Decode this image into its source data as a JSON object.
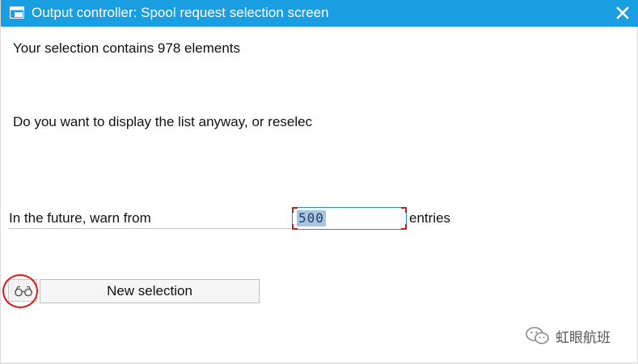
{
  "window": {
    "title": "Output controller: Spool request selection screen",
    "title_icon": "dialog-window-icon",
    "close_icon": "close-icon",
    "accent_color": "#1a9ee2"
  },
  "messages": {
    "line1": "Your selection contains 978 elements",
    "line2": "Do you want to display the list anyway, or reselec"
  },
  "warn": {
    "label": "In the future, warn from",
    "value": "500",
    "unit": "entries"
  },
  "buttons": {
    "display_icon": "glasses-icon",
    "new_selection": "New selection"
  },
  "watermark": {
    "text": "虹眼航班"
  }
}
